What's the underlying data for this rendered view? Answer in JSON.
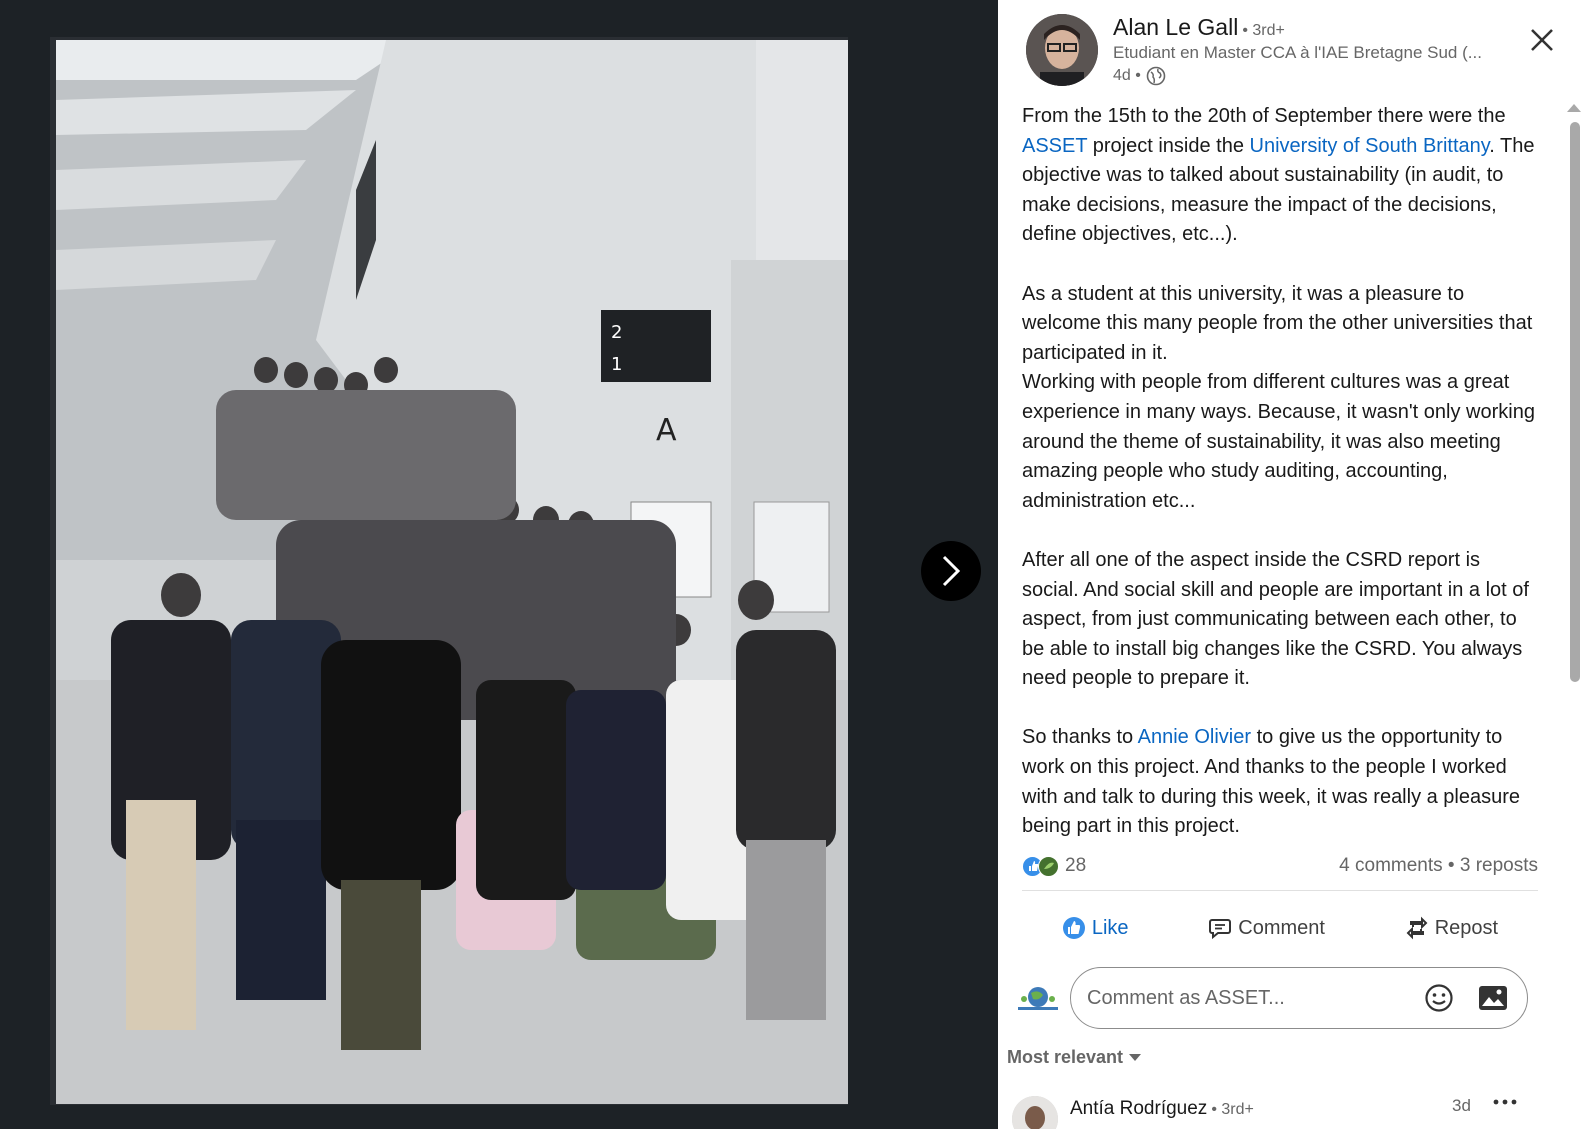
{
  "author": {
    "name": "Alan Le Gall",
    "degree": "• 3rd+",
    "headline": "Etudiant en Master CCA à l'IAE Bretagne Sud (...",
    "time": "4d •",
    "visibility_icon": "globe-icon"
  },
  "post": {
    "p1_a": "From the 15th to the 20th of September there were the ",
    "p1_link1": "ASSET",
    "p1_b": " project inside the ",
    "p1_link2": "University of South Brittany",
    "p1_c": ". The objective was to talked about sustainability (in audit, to make decisions, measure the impact of the decisions, define objectives, etc...).",
    "p2": "As a student at this university, it was a pleasure to welcome this many people from the other universities that participated in it.",
    "p3": "Working with people from different cultures was a great experience in many ways. Because, it wasn't only working around the theme of sustainability, it was also meeting amazing people who study auditing, accounting, administration etc...",
    "p4": "After all one of the aspect inside the CSRD report is social. And social skill and people are important in a lot of aspect, from just communicating between each other, to be able to install big changes like the CSRD. You always need people to prepare it.",
    "p5_a": "So thanks to ",
    "p5_link": "Annie Olivier",
    "p5_b": " to give us the opportunity to work on this project. And thanks to the people I worked with and talk to during this week, it was really a pleasure being part in this project."
  },
  "social": {
    "reaction_count": "28",
    "comments_reposts": "4 comments • 3 reposts"
  },
  "actions": {
    "like": "Like",
    "comment": "Comment",
    "repost": "Repost"
  },
  "comment_box": {
    "placeholder": "Comment as ASSET..."
  },
  "sort": {
    "label": "Most relevant"
  },
  "first_comment": {
    "name": "Antía Rodríguez",
    "degree": "• 3rd+",
    "time": "3d"
  },
  "colors": {
    "link": "#0a66c2",
    "media_bg": "#1d2226"
  }
}
